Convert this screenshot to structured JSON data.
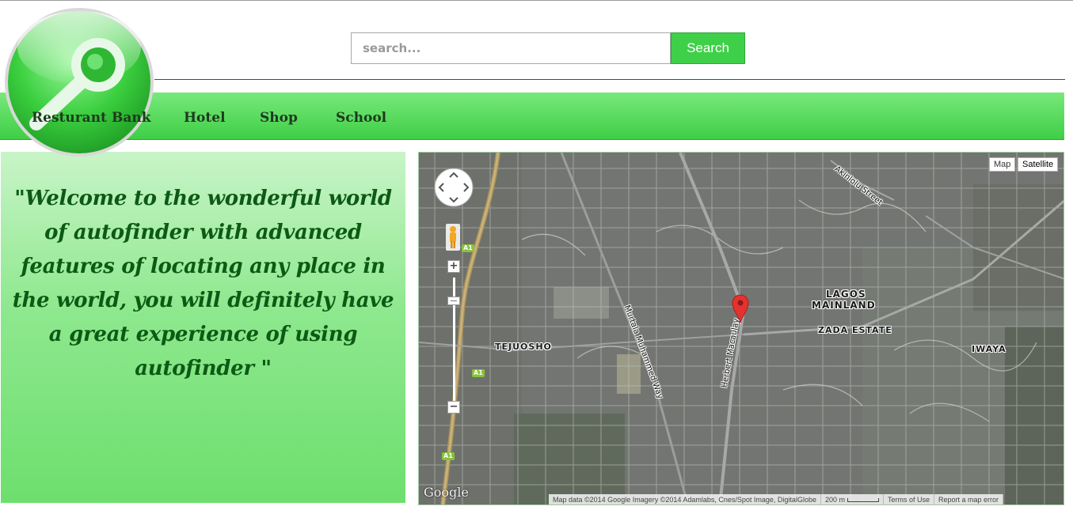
{
  "search": {
    "placeholder": "search...",
    "button_label": "Search"
  },
  "nav": {
    "items": [
      {
        "label": "Resturant"
      },
      {
        "label": "Bank"
      },
      {
        "label": "Hotel"
      },
      {
        "label": "Shop"
      },
      {
        "label": "School"
      }
    ]
  },
  "welcome": {
    "text": "\"Welcome to the wonderful world of autofinder with advanced features of locating any place in the world, you will definitely have a great experience of using autofinder \""
  },
  "map": {
    "type_buttons": {
      "map": "Map",
      "satellite": "Satellite"
    },
    "labels": {
      "lagos": "LAGOS",
      "mainland": "MAINLAND",
      "zada": "ZADA ESTATE",
      "iwaya": "IWAYA",
      "tejuosho": "TEJUOSHO"
    },
    "roads": {
      "murtala": "Murtala Muhammed Way",
      "herbert": "Herbert Macaulay",
      "akinlolu": "Akinlolu Street"
    },
    "highway_badge": "A1",
    "logo_text": "Google",
    "attribution": {
      "data": "Map data ©2014 Google Imagery ©2014 Adamlabs, Cnes/Spot Image, DigitalGlobe",
      "scale": "200 m",
      "terms": "Terms of Use",
      "report": "Report a map error"
    },
    "icons": [
      "pan-control-icon",
      "pegman-icon",
      "zoom-in-icon",
      "zoom-out-icon",
      "map-marker-icon"
    ]
  },
  "colors": {
    "brand_green": "#3fd049",
    "dark_green_text": "#0c5a14",
    "nav_text": "#1e3a1e"
  }
}
